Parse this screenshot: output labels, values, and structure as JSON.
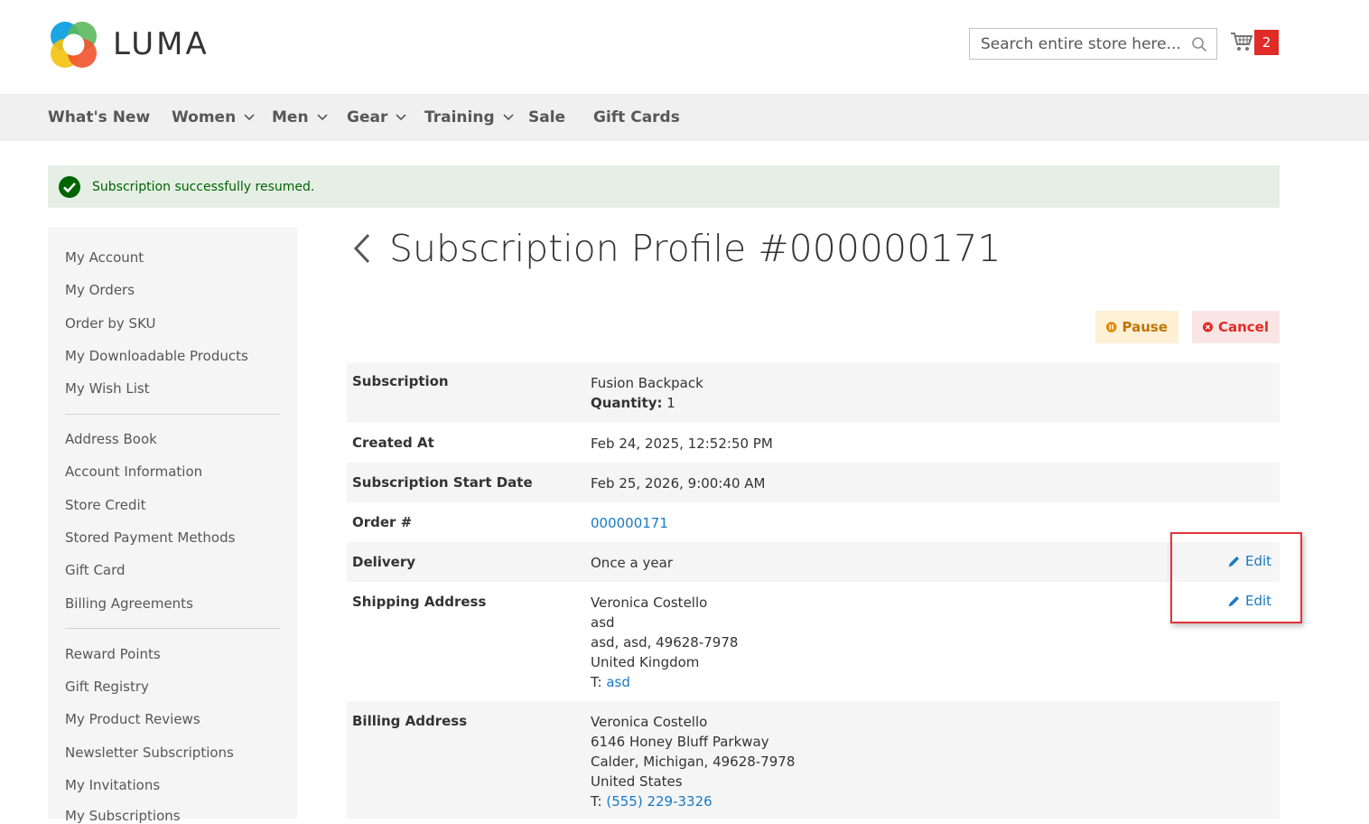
{
  "header": {
    "logo_text": "LUMA",
    "search_placeholder": "Search entire store here...",
    "cart_count": "2"
  },
  "nav": {
    "items": [
      {
        "label": "What's New",
        "has_dropdown": false
      },
      {
        "label": "Women",
        "has_dropdown": true
      },
      {
        "label": "Men",
        "has_dropdown": true
      },
      {
        "label": "Gear",
        "has_dropdown": true
      },
      {
        "label": "Training",
        "has_dropdown": true
      },
      {
        "label": "Sale",
        "has_dropdown": false
      },
      {
        "label": "Gift Cards",
        "has_dropdown": false
      }
    ]
  },
  "message": {
    "text": "Subscription successfully resumed.",
    "color": "#006400"
  },
  "sidebar": {
    "groups": [
      [
        "My Account",
        "My Orders",
        "Order by SKU",
        "My Downloadable Products",
        "My Wish List"
      ],
      [
        "Address Book",
        "Account Information",
        "Store Credit",
        "Stored Payment Methods",
        "Gift Card",
        "Billing Agreements"
      ],
      [
        "Reward Points",
        "Gift Registry",
        "My Product Reviews",
        "Newsletter Subscriptions",
        "My Invitations",
        "My Subscriptions"
      ]
    ]
  },
  "main": {
    "title": "Subscription Profile #000000171",
    "actions": {
      "pause_label": "Pause",
      "cancel_label": "Cancel"
    },
    "details": {
      "subscription": {
        "label": "Subscription",
        "product": "Fusion Backpack",
        "quantity_label": "Quantity:",
        "quantity": "1"
      },
      "created_at": {
        "label": "Created At",
        "value": "Feb 24, 2025, 12:52:50 PM"
      },
      "start_date": {
        "label": "Subscription Start Date",
        "value": "Feb 25, 2026, 9:00:40 AM"
      },
      "order": {
        "label": "Order #",
        "value": "000000171"
      },
      "delivery": {
        "label": "Delivery",
        "value": "Once a year",
        "edit_label": "Edit"
      },
      "shipping": {
        "label": "Shipping Address",
        "lines": [
          "Veronica Costello",
          "asd",
          "asd, asd, 49628-7978",
          "United Kingdom"
        ],
        "phone_prefix": "T:",
        "phone": "asd",
        "edit_label": "Edit"
      },
      "billing": {
        "label": "Billing Address",
        "lines": [
          "Veronica Costello",
          "6146 Honey Bluff Parkway",
          "Calder, Michigan, 49628-7978",
          "United States"
        ],
        "phone_prefix": "T:",
        "phone": "(555) 229-3326"
      }
    }
  },
  "colors": {
    "link": "#1979c3",
    "cart_badge": "#e02b27",
    "highlight": "#e0353a"
  }
}
